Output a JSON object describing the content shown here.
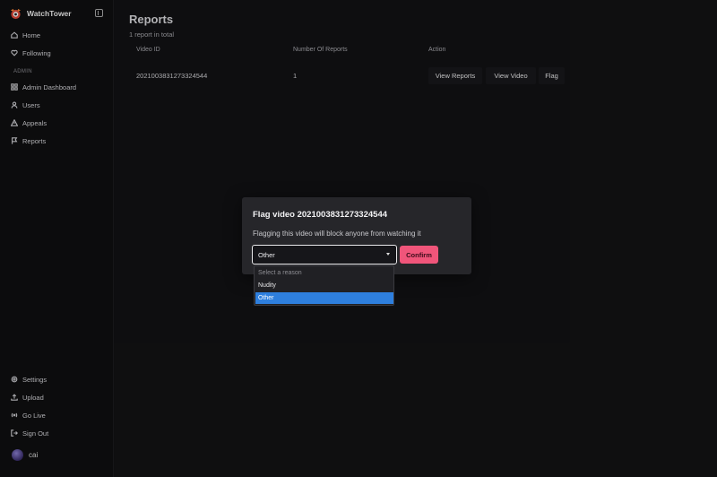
{
  "app": {
    "name": "WatchTower"
  },
  "sidebar": {
    "items": [
      {
        "label": "Home",
        "icon": "home-icon"
      },
      {
        "label": "Following",
        "icon": "heart-icon"
      }
    ],
    "admin_section": "ADMIN",
    "admin_items": [
      {
        "label": "Admin Dashboard",
        "icon": "grid-icon"
      },
      {
        "label": "Users",
        "icon": "user-icon"
      },
      {
        "label": "Appeals",
        "icon": "warning-icon"
      },
      {
        "label": "Reports",
        "icon": "flag-icon"
      }
    ],
    "bottom_items": [
      {
        "label": "Settings",
        "icon": "gear-icon"
      },
      {
        "label": "Upload",
        "icon": "upload-icon"
      },
      {
        "label": "Go Live",
        "icon": "broadcast-icon"
      },
      {
        "label": "Sign Out",
        "icon": "sign-out-icon"
      }
    ],
    "user": {
      "name": "cai"
    }
  },
  "page": {
    "title": "Reports",
    "subtitle": "1 report in total"
  },
  "table": {
    "columns": [
      "Video ID",
      "Number Of Reports",
      "Action"
    ],
    "rows": [
      {
        "video_id": "2021003831273324544",
        "count": "1"
      }
    ],
    "actions": [
      "View Reports",
      "View Video",
      "Flag"
    ]
  },
  "modal": {
    "title": "Flag video 2021003831273324544",
    "description": "Flagging this video will block anyone from watching it",
    "selected": "Other",
    "confirm_label": "Confirm",
    "options": [
      "Select a reason",
      "Nudity",
      "Other"
    ]
  },
  "colors": {
    "confirm": "#f0557a",
    "selected_option": "#2e7fde",
    "background": "#121214"
  }
}
